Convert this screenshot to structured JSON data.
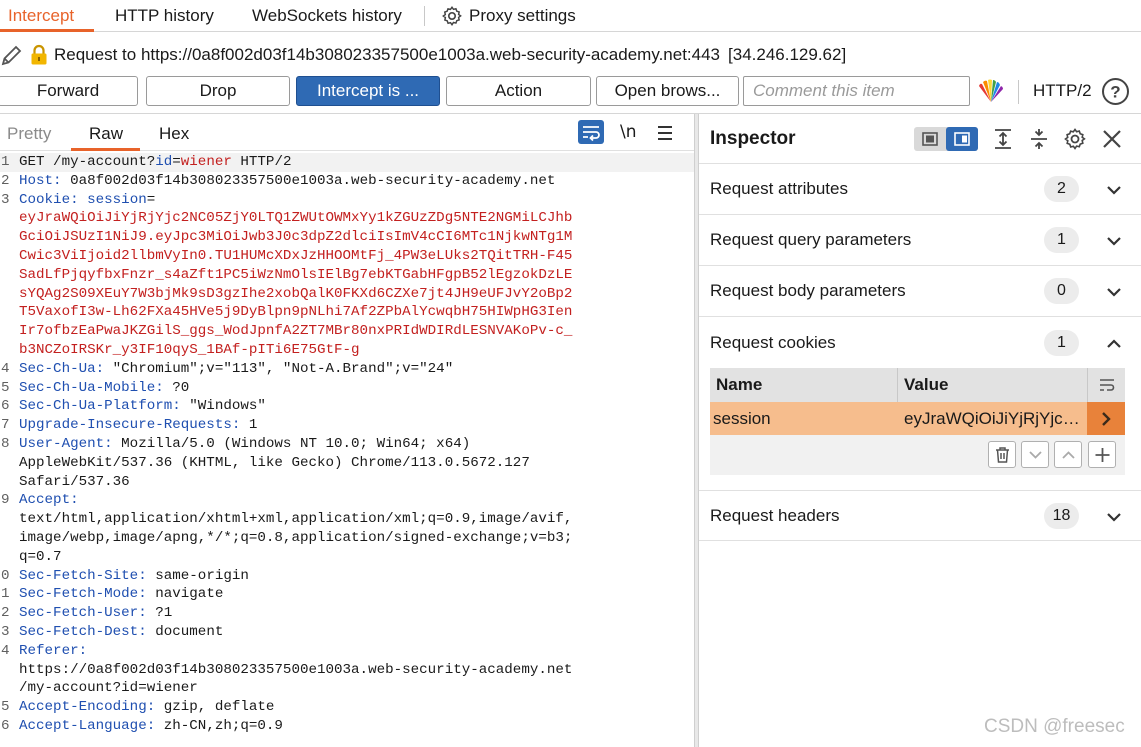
{
  "top_tabs": [
    {
      "label": "Intercept",
      "active": true
    },
    {
      "label": "HTTP history"
    },
    {
      "label": "WebSockets history"
    },
    {
      "label": "Proxy settings"
    }
  ],
  "request_line": {
    "text": "Request to https://0a8f002d03f14b308023357500e1003a.web-security-academy.net:443",
    "ip": "[34.246.129.62]"
  },
  "actions": {
    "forward": "Forward",
    "drop": "Drop",
    "intercept": "Intercept is ...",
    "action": "Action",
    "open_browser": "Open brows...",
    "comment_placeholder": "Comment this item",
    "protocol": "HTTP/2"
  },
  "editor_tabs": {
    "pretty": "Pretty",
    "raw": "Raw",
    "hex": "Hex",
    "newline": "\\n"
  },
  "request_lines": {
    "l1_method": "GET /my-account?",
    "l1_param": "id",
    "l1_eq": "=",
    "l1_value": "wiener",
    "l1_proto": " HTTP/2",
    "host_k": "Host:",
    "host_v": " 0a8f002d03f14b308023357500e1003a.web-security-academy.net",
    "cookie_k": "Cookie:",
    "cookie_name": " session",
    "cookie_eq": "=",
    "cookie_v1": "eyJraWQiOiJiYjRjYjc2NC05ZjY0LTQ1ZWUtOWMxYy1kZGUzZDg5NTE2NGMiLCJhb",
    "cookie_v2": "GciOiJSUzI1NiJ9.eyJpc3MiOiJwb3J0c3dpZ2dlciIsImV4cCI6MTc1NjkwNTg1M",
    "cookie_v3": "Cwic3ViIjoid2llbmVyIn0.TU1HUMcXDxJzHHOOMtFj_4PW3eLUks2TQitTRH-F45",
    "cookie_v4": "SadLfPjqyfbxFnzr_s4aZft1PC5iWzNmOlsIElBg7ebKTGabHFgpB52lEgzokDzLE",
    "cookie_v5": "sYQAg2S09XEuY7W3bjMk9sD3gzIhe2xobQalK0FKXd6CZXe7jt4JH9eUFJvY2oBp2",
    "cookie_v6": "T5VaxofI3w-Lh62FXa45HVe5j9DyBlpn9pNLhi7Af2ZPbAlYcwqbH75HIWpHG3Ien",
    "cookie_v7": "Ir7ofbzEaPwaJKZGilS_ggs_WodJpnfA2ZT7MBr80nxPRIdWDIRdLESNVAKoPv-c_",
    "cookie_v8": "b3NCZoIRSKr_y3IF10qyS_1BAf-pITi6E75GtF-g",
    "ua_k": "Sec-Ch-Ua:",
    "ua_v": " \"Chromium\";v=\"113\", \"Not-A.Brand\";v=\"24\"",
    "mob_k": "Sec-Ch-Ua-Mobile:",
    "mob_v": " ?0",
    "plat_k": "Sec-Ch-Ua-Platform:",
    "plat_v": " \"Windows\"",
    "upg_k": "Upgrade-Insecure-Requests:",
    "upg_v": " 1",
    "agent_k": "User-Agent:",
    "agent_v1": " Mozilla/5.0 (Windows NT 10.0; Win64; x64)",
    "agent_v2": "AppleWebKit/537.36 (KHTML, like Gecko) Chrome/113.0.5672.127",
    "agent_v3": "Safari/537.36",
    "accept_k": "Accept:",
    "accept_v1": "text/html,application/xhtml+xml,application/xml;q=0.9,image/avif,",
    "accept_v2": "image/webp,image/apng,*/*;q=0.8,application/signed-exchange;v=b3;",
    "accept_v3": "q=0.7",
    "site_k": "Sec-Fetch-Site:",
    "site_v": " same-origin",
    "mode_k": "Sec-Fetch-Mode:",
    "mode_v": " navigate",
    "user_k": "Sec-Fetch-User:",
    "user_v": " ?1",
    "dest_k": "Sec-Fetch-Dest:",
    "dest_v": " document",
    "ref_k": "Referer:",
    "ref_v1": "https://0a8f002d03f14b308023357500e1003a.web-security-academy.net",
    "ref_v2": "/my-account?id=wiener",
    "enc_k": "Accept-Encoding:",
    "enc_v": " gzip, deflate",
    "lang_k": "Accept-Language:",
    "lang_v": " zh-CN,zh;q=0.9"
  },
  "line_numbers": [
    "1",
    "2",
    "3",
    "",
    "",
    "",
    "",
    "",
    "",
    "",
    "4",
    "5",
    "6",
    "7",
    "8",
    "",
    "",
    "9",
    "",
    "",
    "",
    "0",
    "1",
    "2",
    "3",
    "4",
    "",
    "",
    "5",
    "6"
  ],
  "inspector": {
    "title": "Inspector",
    "sections": [
      {
        "label": "Request attributes",
        "count": "2"
      },
      {
        "label": "Request query parameters",
        "count": "1"
      },
      {
        "label": "Request body parameters",
        "count": "0"
      },
      {
        "label": "Request cookies",
        "count": "1"
      },
      {
        "label": "Request headers",
        "count": "18"
      }
    ],
    "cookie_table": {
      "col_name": "Name",
      "col_value": "Value",
      "row_name": "session",
      "row_value": "eyJraWQiOiJiYjRjYjc2N..."
    }
  },
  "watermark": "CSDN @freesec",
  "colors": {
    "accent_orange": "#e8632a",
    "primary_blue": "#2f6ab4",
    "header_key_blue": "#1f4fb0",
    "cookie_value_red": "#c3201f",
    "selected_row": "#f6bd8d"
  }
}
